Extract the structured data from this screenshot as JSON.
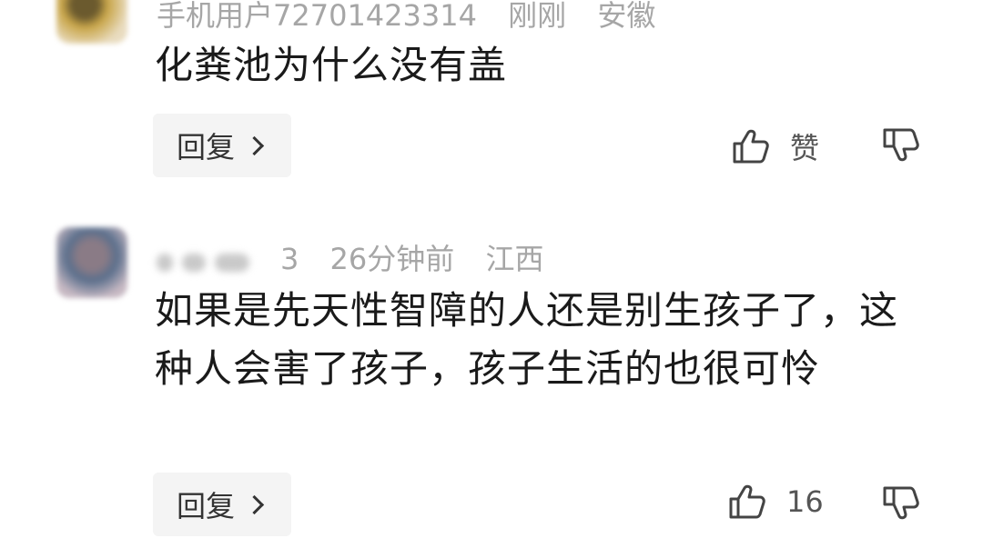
{
  "comments": [
    {
      "username": "手机用户72701423314",
      "time": "刚刚",
      "location": "安徽",
      "text": "化粪池为什么没有盖",
      "reply_label": "回复",
      "like_label": "赞"
    },
    {
      "username_tail": "3",
      "time": "26分钟前",
      "location": "江西",
      "text": "如果是先天性智障的人还是别生孩子了，这种人会害了孩子，孩子生活的也很可怜",
      "reply_label": "回复",
      "like_label": "16"
    }
  ],
  "icons": {
    "like": "thumb-up-icon",
    "dislike": "thumb-down-icon",
    "reply_arrow": "chevron-right-icon"
  },
  "colors": {
    "meta_text": "#a6a6a6",
    "body_text": "#1a1a1a",
    "reply_bg": "#f4f4f4"
  }
}
